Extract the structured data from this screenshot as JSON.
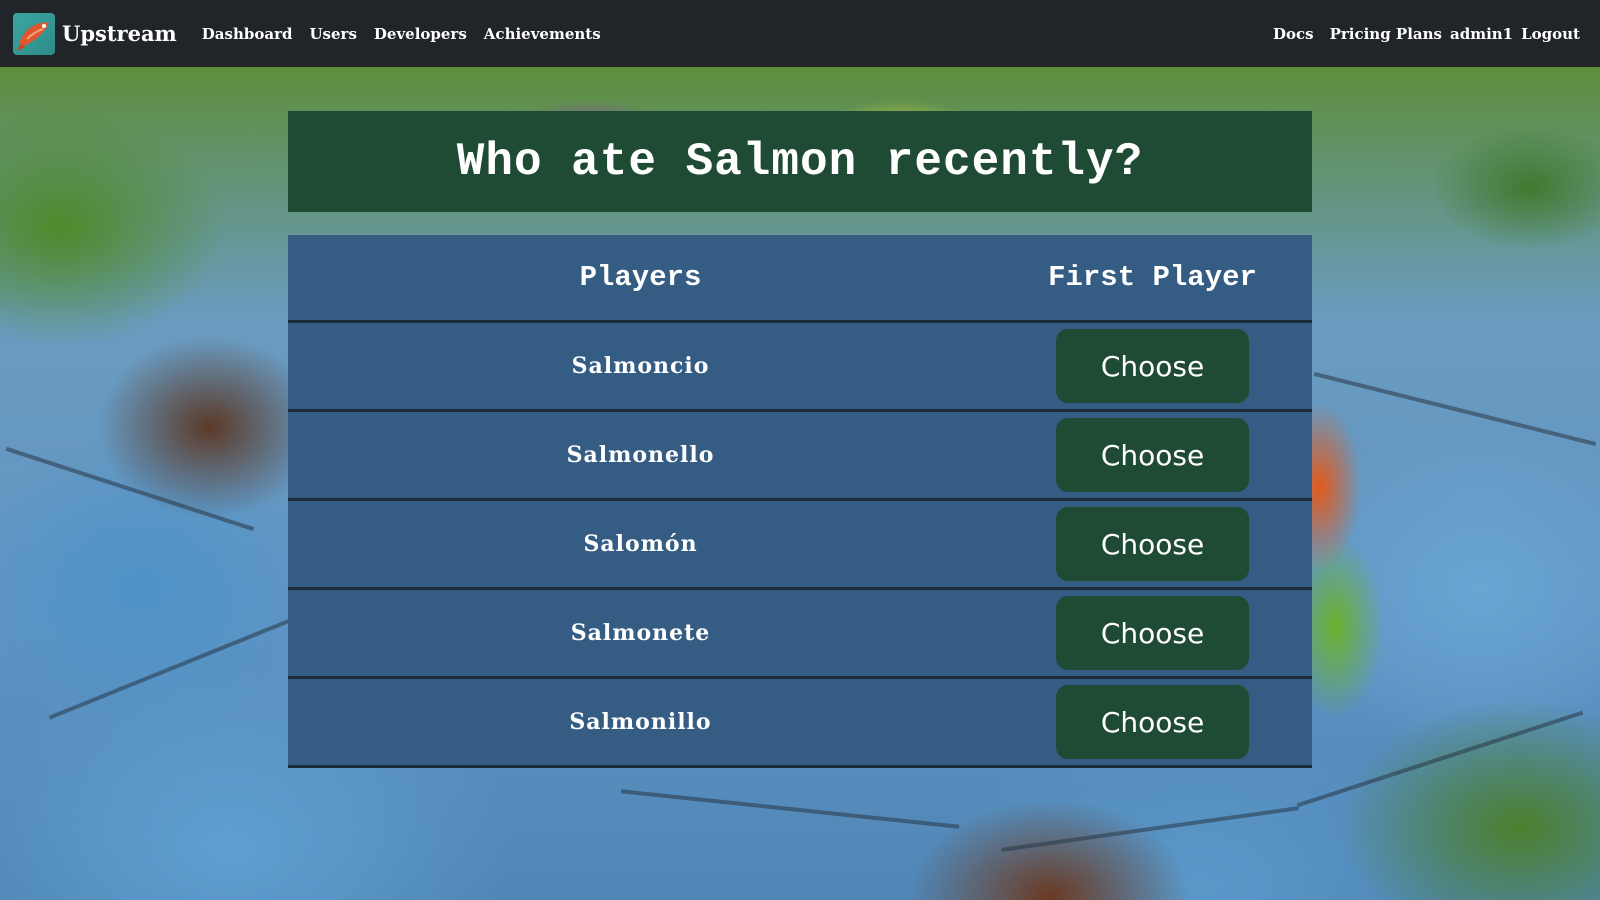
{
  "navbar": {
    "brand": "Upstream",
    "left_links": [
      "Dashboard",
      "Users",
      "Developers",
      "Achievements"
    ],
    "right_links": [
      "Docs",
      "Pricing Plans",
      "admin1",
      "Logout"
    ]
  },
  "main": {
    "title": "Who ate Salmon recently?",
    "table": {
      "headers": [
        "Players",
        "First Player"
      ],
      "rows": [
        {
          "player": "Salmoncio",
          "action": "Choose"
        },
        {
          "player": "Salmonello",
          "action": "Choose"
        },
        {
          "player": "Salomón",
          "action": "Choose"
        },
        {
          "player": "Salmonete",
          "action": "Choose"
        },
        {
          "player": "Salmonillo",
          "action": "Choose"
        }
      ]
    }
  },
  "colors": {
    "navbar": "#212529",
    "title_banner": "#1f4a33",
    "table_bg": "#355d83",
    "button": "#1f4a33"
  },
  "icons": {
    "logo": "salmon-logo-icon"
  }
}
